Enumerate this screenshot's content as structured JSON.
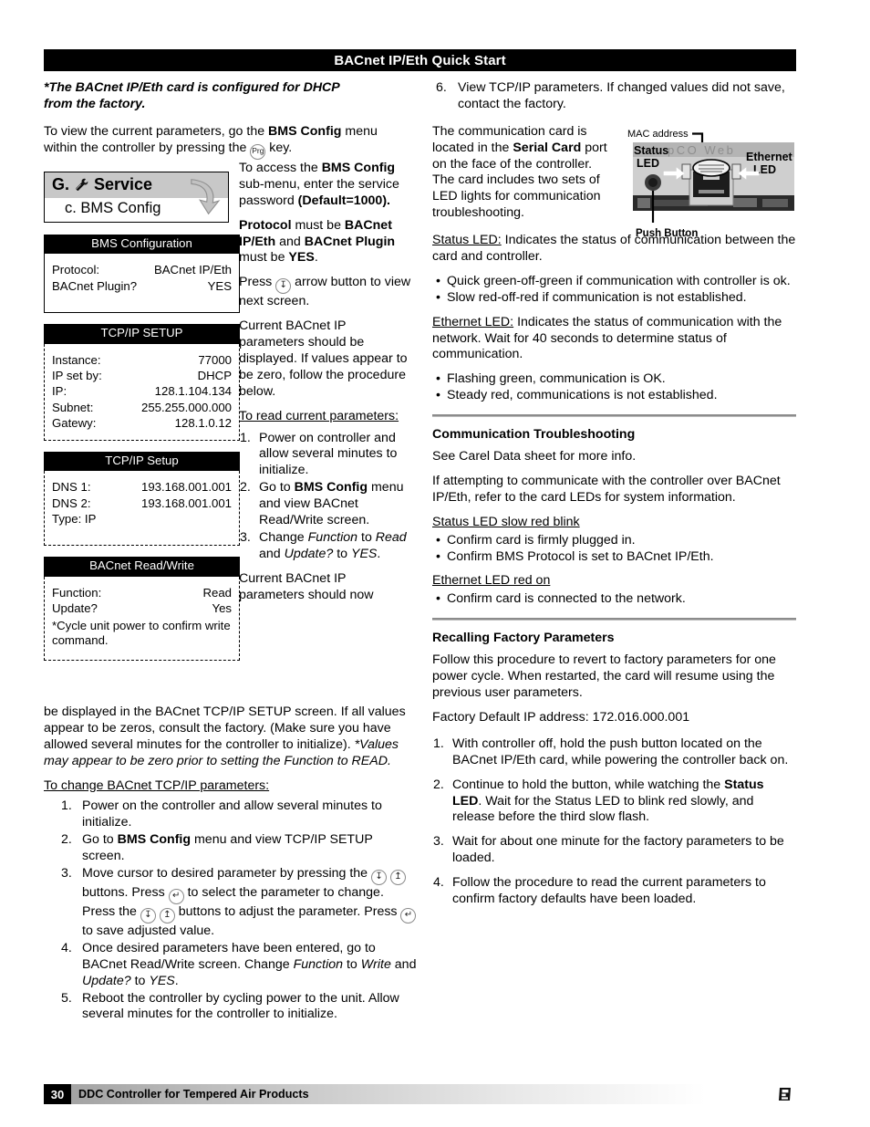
{
  "header": {
    "title": "BACnet IP/Eth Quick Start"
  },
  "intro": {
    "note_line1": "*The BACnet IP/Eth card is configured for DHCP",
    "note_line2": "from the factory.",
    "view_params_a": "To view the current parameters, go the ",
    "view_params_b": "BMS Config",
    "view_params_c": " menu within the controller by pressing the ",
    "view_params_d": " key.",
    "prg_key_label": "Prg"
  },
  "service_menu": {
    "letter": "G.",
    "title": "Service",
    "submenu": "c. BMS Config",
    "wrench_icon": "wrench-icon",
    "arrow_icon": "curved-arrow-icon"
  },
  "lcd_screens": [
    {
      "name": "bms-configuration",
      "title": "BMS Configuration",
      "border": "solid",
      "rows": [
        {
          "key": "Protocol:",
          "value": "BACnet IP/Eth"
        },
        {
          "key": "BACnet Plugin?",
          "value": "YES"
        }
      ],
      "note": ""
    },
    {
      "name": "tcpip-setup-1",
      "title": "TCP/IP SETUP",
      "border": "dashed",
      "rows": [
        {
          "key": "Instance:",
          "value": "77000"
        },
        {
          "key": "IP set by:",
          "value": "DHCP"
        },
        {
          "key": "IP:",
          "value": "128.1.104.134"
        },
        {
          "key": "Subnet:",
          "value": "255.255.000.000"
        },
        {
          "key": "Gatewy:",
          "value": "128.1.0.12"
        }
      ],
      "note": ""
    },
    {
      "name": "tcpip-setup-2",
      "title": "TCP/IP Setup",
      "border": "dashed",
      "rows": [
        {
          "key": "DNS 1:",
          "value": "193.168.001.001"
        },
        {
          "key": "DNS 2:",
          "value": "193.168.001.001"
        },
        {
          "key": "Type: IP",
          "value": ""
        }
      ],
      "note": ""
    },
    {
      "name": "bacnet-read-write",
      "title": "BACnet Read/Write",
      "border": "dashed",
      "rows": [
        {
          "key": "Function:",
          "value": "Read"
        },
        {
          "key": "Update?",
          "value": "Yes"
        }
      ],
      "note": "*Cycle unit power to confirm write command."
    }
  ],
  "mid_column": {
    "p1_a": "To access the ",
    "p1_b": "BMS Config",
    "p1_c": " sub-menu, enter the service password ",
    "p1_d": "(Default=1000).",
    "p2_a": "Protocol",
    "p2_b": " must be ",
    "p2_c": "BACnet IP/Eth",
    "p2_d": " and ",
    "p2_e": "BACnet Plugin",
    "p2_f": " must be ",
    "p2_g": "YES",
    "p2_h": ".",
    "p3_a": "Press ",
    "p3_b": " arrow button to view next screen.",
    "p4": "Current BACnet IP parameters should be displayed. If values appear to be zero, follow the procedure below.",
    "heading_read": "To read current parameters:",
    "steps": [
      {
        "parts": [
          "Power on controller and allow several minutes to initialize."
        ]
      },
      {
        "parts": [
          "Go to ",
          "BMS Config",
          " menu and view BACnet Read/Write screen."
        ]
      },
      {
        "parts": [
          "Change ",
          "Function",
          " to ",
          "Read",
          " and ",
          "Update?",
          " to ",
          "YES",
          "."
        ]
      }
    ],
    "p5_lead": "Current BACnet IP parameters should now"
  },
  "full_width": {
    "para_a": "be displayed in the BACnet TCP/IP SETUP screen. If all values appear to be zeros, consult the factory. (Make sure you have allowed several minutes for the controller to initialize). ",
    "para_b": "*Values may appear to be zero prior to setting the Function to READ.",
    "heading_change": "To change BACnet TCP/IP parameters:",
    "steps": [
      "Power on the controller and allow several minutes to initialize.",
      "Go to BMS Config menu and view TCP/IP SETUP screen.",
      "Move cursor to desired parameter by pressing the down/up buttons. Press enter to select the parameter to change. Press the down/up buttons to adjust the parameter. Press enter to save adjusted value.",
      "Once desired parameters have been entered, go to BACnet Read/Write screen. Change Function to Write and Update? to YES.",
      "Reboot the controller by cycling power to the unit. Allow several minutes for the controller to initialize."
    ]
  },
  "right_column": {
    "step6_num": "6.",
    "step6_text": "View TCP/IP parameters. If changed values did not save, contact the factory.",
    "card_para_a": "The communication card is located in the ",
    "card_para_b": "Serial Card",
    "card_para_c": " port on the face of the controller. The card includes two sets of LED lights for communication troubleshooting.",
    "figure": {
      "mac_label": "MAC address",
      "status_label_l1": "Status",
      "status_label_l2": "LED",
      "ethernet_label_l1": "Ethernet",
      "ethernet_label_l2": "LED",
      "push_button_label": "Push Button",
      "brand_text": "pCO Web"
    },
    "status_led": {
      "term": "Status LED:",
      "desc": " Indicates the status of communication between the card and controller.",
      "bullets": [
        "Quick green-off-green if communication with controller is ok.",
        "Slow red-off-red if communication is not established."
      ]
    },
    "ethernet_led": {
      "term": "Ethernet LED:",
      "desc": " Indicates the status of communication with the network. Wait for 40 seconds to determine status of communication.",
      "bullets": [
        "Flashing green, communication is OK.",
        "Steady red, communications is not established."
      ]
    },
    "troubleshooting": {
      "heading": "Communication Troubleshooting",
      "p1": "See Carel Data sheet for more info.",
      "p2": "If attempting to communicate with the controller over BACnet IP/Eth, refer to the card LEDs for system information.",
      "sub1": "Status LED slow red blink",
      "sub1_bullets": [
        "Confirm card is firmly plugged in.",
        "Confirm BMS Protocol is set to BACnet IP/Eth."
      ],
      "sub2": "Ethernet LED red on",
      "sub2_bullets": [
        "Confirm card is connected to the network."
      ]
    },
    "recalling": {
      "heading": "Recalling Factory Parameters",
      "p1": "Follow this procedure to revert to factory parameters for one power cycle. When restarted, the card will resume using the previous user parameters.",
      "p2": "Factory Default IP address: 172.016.000.001",
      "steps": [
        {
          "parts": [
            "With controller off, hold the push button located on the BACnet IP/Eth card, while powering the controller back on."
          ]
        },
        {
          "parts": [
            "Continue to hold the button, while watching the ",
            "Status LED",
            ". Wait for the Status LED to blink red slowly, and release before the third slow flash."
          ]
        },
        {
          "parts": [
            "Wait for about one minute for the factory parameters to be loaded."
          ]
        },
        {
          "parts": [
            "Follow the procedure to read the current parameters to confirm factory defaults have been loaded."
          ]
        }
      ]
    }
  },
  "footer": {
    "page_number": "30",
    "text": "DDC Controller for Tempered Air Products",
    "logo": "company-logo"
  }
}
